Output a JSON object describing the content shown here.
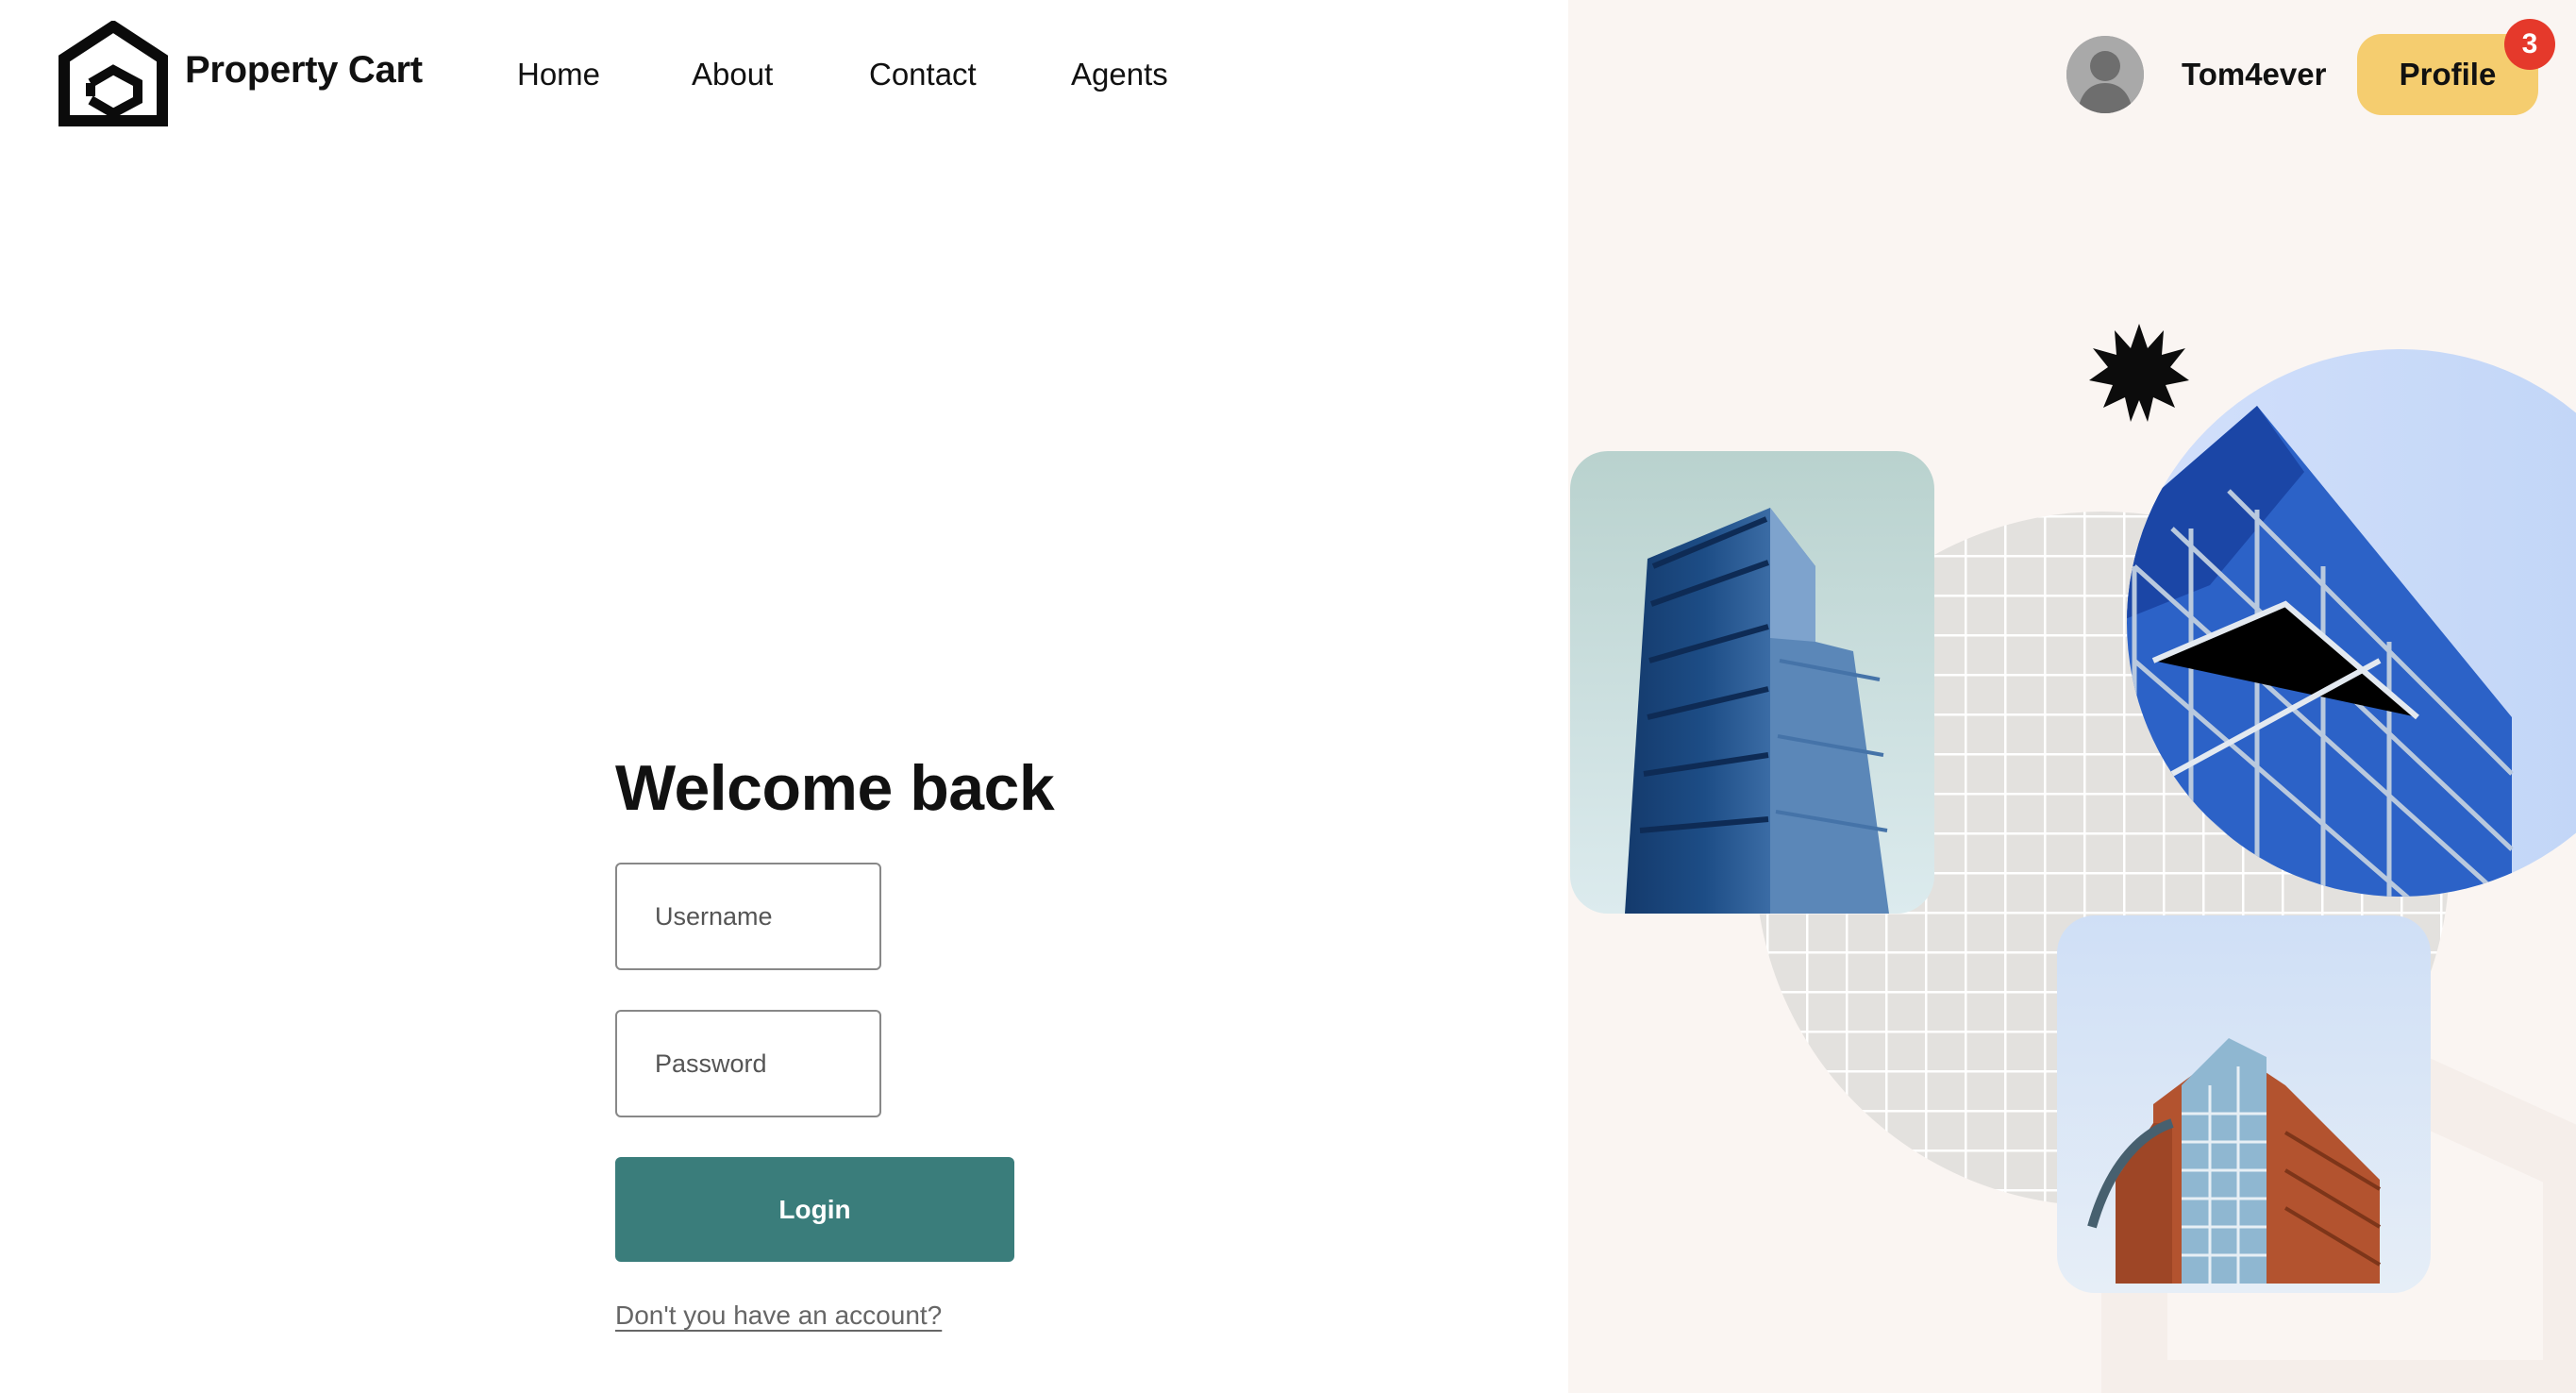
{
  "header": {
    "brand_name": "Property Cart",
    "nav": [
      {
        "label": "Home"
      },
      {
        "label": "About"
      },
      {
        "label": "Contact"
      },
      {
        "label": "Agents"
      }
    ],
    "user": {
      "username": "Tom4ever",
      "profile_label": "Profile",
      "notification_count": "3"
    }
  },
  "login": {
    "title": "Welcome back",
    "username_placeholder": "Username",
    "password_placeholder": "Password",
    "login_label": "Login",
    "signup_link": "Don't you have an account?"
  },
  "colors": {
    "accent_teal": "#3a7d7b",
    "profile_yellow": "#f5cd6f",
    "badge_red": "#e5392b",
    "panel_background": "#faf5f2"
  },
  "icons": [
    "logo-icon",
    "avatar-icon",
    "starburst-icon"
  ]
}
